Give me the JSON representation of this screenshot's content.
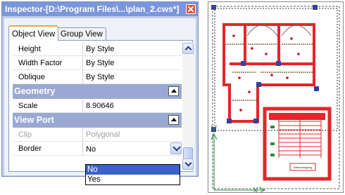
{
  "window": {
    "title": "Inspector-[D:\\Program Files\\...\\plan_2.cws*]"
  },
  "tabs": [
    {
      "label": "Object View",
      "active": true
    },
    {
      "label": "Group View",
      "active": false
    }
  ],
  "properties": {
    "rows_top": [
      {
        "key": "Height",
        "value": "By Style"
      },
      {
        "key": "Width Factor",
        "value": "By Style"
      },
      {
        "key": "Oblique",
        "value": "By Style"
      }
    ],
    "geometry": {
      "label": "Geometry",
      "rows": [
        {
          "key": "Scale",
          "value": "8.90646"
        }
      ]
    },
    "view_port": {
      "label": "View Port",
      "rows": [
        {
          "key": "Clip",
          "value": "Polygonal",
          "disabled": true
        },
        {
          "key": "Border",
          "value": "No"
        }
      ]
    }
  },
  "border_dropdown": {
    "options": [
      "No",
      "Yes"
    ],
    "selected": "No"
  },
  "drawing": {
    "stair_caption": "Wareneingang"
  },
  "colors": {
    "title_bar": "#7a96dc",
    "category_header": "#9aa9d3",
    "selection": "#3b62c4",
    "wall_red": "#e3262b",
    "handle_blue": "#3a3f9a"
  }
}
